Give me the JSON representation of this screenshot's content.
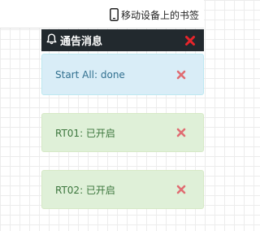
{
  "bookmark": {
    "label": "移动设备上的书签",
    "icon": "mobile-phone-icon"
  },
  "panel": {
    "title": "通告消息",
    "icon": "bell-icon",
    "close_icon": "close-icon",
    "header_color": "#22292e",
    "close_color": "#e8252b"
  },
  "alerts": [
    {
      "text": "Start All: done",
      "type": "info",
      "color": "#31708f"
    },
    {
      "text": "RT01: 已开启",
      "type": "success",
      "color": "#3c763d"
    },
    {
      "text": "RT02: 已开启",
      "type": "success",
      "color": "#3c763d"
    }
  ],
  "alert_close_color": "#e06c72"
}
